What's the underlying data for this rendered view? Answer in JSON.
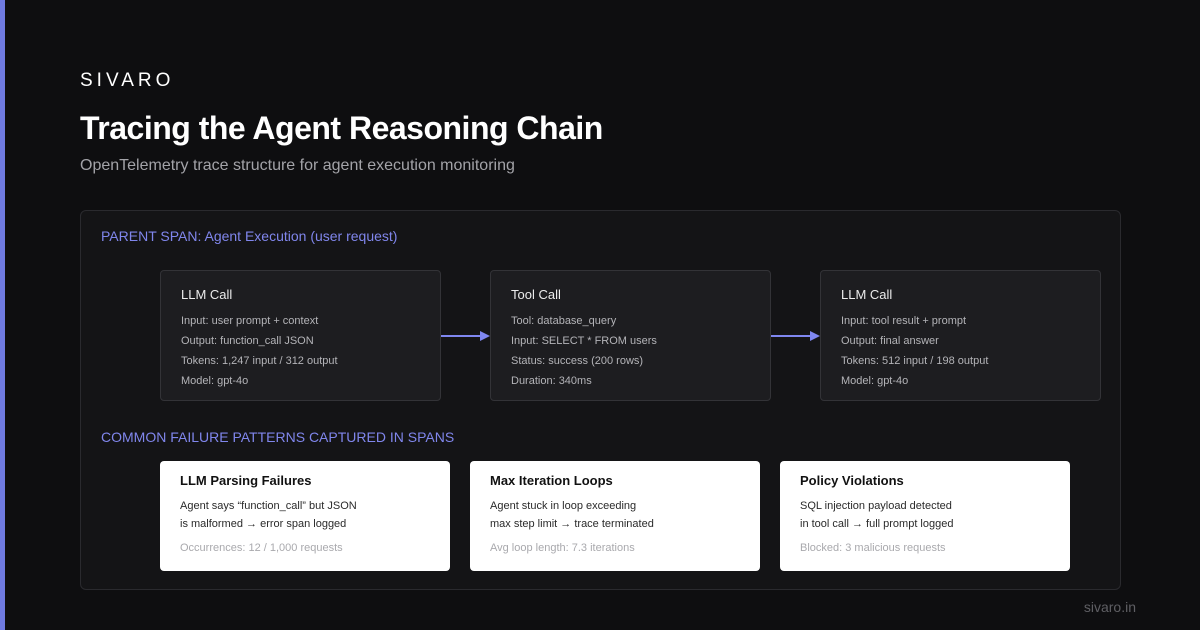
{
  "brand": "SIVARO",
  "title": "Tracing the Agent Reasoning Chain",
  "subtitle": "OpenTelemetry trace structure for agent execution monitoring",
  "parent_span_label": "PARENT SPAN: Agent Execution (user request)",
  "spans": [
    {
      "title": "LLM Call",
      "lines": [
        "Input: user prompt + context",
        "Output: function_call JSON",
        "Tokens: 1,247 input / 312 output",
        "Model: gpt-4o"
      ]
    },
    {
      "title": "Tool Call",
      "lines": [
        "Tool: database_query",
        "Input: SELECT * FROM users",
        "Status: success (200 rows)",
        "Duration: 340ms"
      ]
    },
    {
      "title": "LLM Call",
      "lines": [
        "Input: tool result + prompt",
        "Output: final answer",
        "Tokens: 512 input / 198 output",
        "Model: gpt-4o"
      ]
    }
  ],
  "failures_label": "COMMON FAILURE PATTERNS CAPTURED IN SPANS",
  "failures": [
    {
      "title": "LLM Parsing Failures",
      "desc": [
        "Agent says “function_call” but JSON",
        "is malformed → error span logged"
      ],
      "stat": "Occurrences: 12 / 1,000 requests"
    },
    {
      "title": "Max Iteration Loops",
      "desc": [
        "Agent stuck in loop exceeding",
        "max step limit → trace terminated"
      ],
      "stat": "Avg loop length: 7.3 iterations"
    },
    {
      "title": "Policy Violations",
      "desc": [
        "SQL injection payload detected",
        "in tool call → full prompt logged"
      ],
      "stat": "Blocked: 3 malicious requests"
    }
  ],
  "footer": "sivaro.in",
  "colors": {
    "accent": "#6f7ae0",
    "section_label": "#8086ec",
    "arrow": "#7f87f0",
    "background": "#0e0e10",
    "card": "#ffffff"
  }
}
